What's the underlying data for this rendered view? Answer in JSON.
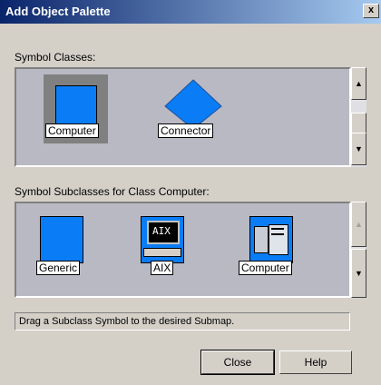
{
  "window": {
    "title": "Add Object Palette",
    "close_glyph": "x"
  },
  "classes": {
    "label": "Symbol Classes:",
    "items": [
      {
        "label": "Computer",
        "icon": "computer-class-icon",
        "selected": true
      },
      {
        "label": "Connector",
        "icon": "connector-diamond-icon",
        "selected": false
      }
    ]
  },
  "subclasses": {
    "label": "Symbol Subclasses for Class Computer:",
    "items": [
      {
        "label": "Generic",
        "icon": "generic-square-icon"
      },
      {
        "label": "AIX",
        "icon": "aix-monitor-icon",
        "screen_text": "AIX"
      },
      {
        "label": "Computer",
        "icon": "computer-tower-icon"
      }
    ]
  },
  "status": {
    "text": "Drag a Subclass Symbol to the desired Submap."
  },
  "buttons": {
    "close": "Close",
    "help": "Help"
  },
  "colors": {
    "symbol_blue": "#0a7df6",
    "panel_bg": "#b9b9c4",
    "selection_gray": "#808080"
  }
}
